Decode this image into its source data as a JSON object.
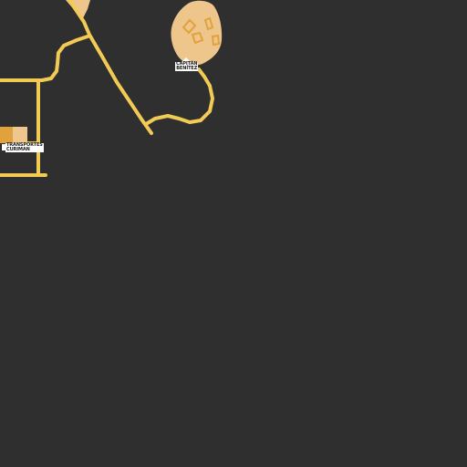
{
  "map": {
    "background_color": "#2f2f2f",
    "road_color": "#f2cb55",
    "landuse_color": "#eec58a",
    "building_color": "#e1a23b",
    "building_light_color": "#efc68e",
    "labels": {
      "capitan": {
        "line1": "CAPITÁN",
        "line2": "BENÍTEZ"
      },
      "transports": {
        "line1": "TRANSPORTES",
        "line2": "CURIMAN"
      }
    }
  }
}
